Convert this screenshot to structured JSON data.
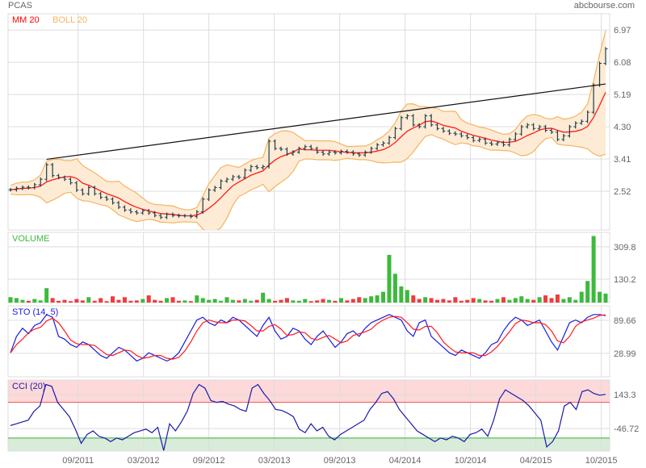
{
  "header": {
    "symbol": "PCAS",
    "source": "abcbourse.com"
  },
  "legend": {
    "ma": "MM 20",
    "boll": "BOLL 20",
    "volume": "VOLUME",
    "sto": "STO (14, 5)",
    "cci": "CCI (20)"
  },
  "colors": {
    "bar": "#1e3d4a",
    "ma": "#ff1a1a",
    "boll": "#f5b461",
    "boll_fill": "#fdebd5",
    "up": "#3cba3c",
    "down": "#f03c3c",
    "sto_k": "#1a1adf",
    "sto_d": "#ff1a1a",
    "cci": "#1a1aaa",
    "grid": "#dddddd"
  },
  "chart_data": [
    {
      "type": "line",
      "name": "price",
      "title": "PCAS",
      "y_ticks": [
        "6.97",
        "6.08",
        "5.19",
        "4.30",
        "3.41",
        "2.52"
      ],
      "ylim": [
        1.45,
        7.42
      ],
      "x_ticks": [
        {
          "label": "09/2011",
          "month": 8
        },
        {
          "label": "03/2012",
          "month": 14
        },
        {
          "label": "09/2012",
          "month": 20
        },
        {
          "label": "03/2013",
          "month": 26
        },
        {
          "label": "09/2013",
          "month": 32
        },
        {
          "label": "04/2014",
          "month": 38
        },
        {
          "label": "10/2014",
          "month": 44
        },
        {
          "label": "04/2015",
          "month": 50
        },
        {
          "label": "10/2015",
          "month": 56
        }
      ],
      "xlim_months": [
        1.8,
        56.4
      ],
      "close": [
        2.56,
        2.6,
        2.63,
        2.62,
        2.7,
        2.85,
        3.25,
        2.95,
        2.9,
        2.85,
        2.75,
        2.55,
        2.45,
        2.62,
        2.45,
        2.35,
        2.3,
        2.2,
        2.08,
        2.0,
        1.95,
        1.92,
        1.98,
        1.92,
        1.85,
        1.8,
        1.88,
        1.85,
        1.84,
        1.84,
        1.82,
        1.95,
        2.3,
        2.55,
        2.62,
        2.8,
        2.85,
        2.92,
        2.9,
        3.1,
        3.2,
        3.17,
        3.2,
        3.9,
        3.7,
        3.68,
        3.55,
        3.6,
        3.7,
        3.75,
        3.7,
        3.6,
        3.55,
        3.6,
        3.58,
        3.62,
        3.6,
        3.55,
        3.52,
        3.6,
        3.7,
        3.8,
        3.85,
        4.0,
        4.25,
        4.55,
        4.6,
        4.35,
        4.3,
        4.6,
        4.35,
        4.25,
        4.18,
        4.12,
        4.1,
        4.05,
        4.0,
        3.92,
        3.95,
        3.85,
        3.82,
        3.86,
        3.8,
        3.95,
        4.1,
        4.3,
        4.35,
        4.25,
        4.3,
        4.2,
        4.15,
        3.95,
        4.05,
        4.3,
        4.4,
        4.45,
        4.7,
        5.45,
        6.05,
        6.45
      ],
      "trendline": {
        "from_index": 6,
        "from_value": 3.4,
        "to_index": 99,
        "to_value": 5.48
      }
    },
    {
      "type": "bar",
      "name": "volume",
      "y_ticks": [
        "309.8",
        "130.2"
      ],
      "ylim": [
        0,
        390
      ],
      "values": [
        30,
        25,
        15,
        10,
        20,
        12,
        80,
        25,
        10,
        15,
        8,
        20,
        12,
        30,
        10,
        25,
        8,
        35,
        15,
        30,
        10,
        12,
        20,
        40,
        15,
        10,
        25,
        30,
        10,
        12,
        8,
        40,
        25,
        15,
        20,
        10,
        30,
        15,
        12,
        20,
        10,
        15,
        55,
        20,
        10,
        15,
        25,
        12,
        10,
        20,
        8,
        12,
        20,
        15,
        10,
        25,
        12,
        20,
        30,
        25,
        35,
        40,
        60,
        265,
        160,
        90,
        70,
        40,
        20,
        30,
        25,
        15,
        20,
        12,
        30,
        10,
        15,
        25,
        20,
        12,
        10,
        20,
        30,
        15,
        25,
        35,
        20,
        15,
        30,
        40,
        25,
        45,
        20,
        30,
        15,
        60,
        120,
        370,
        60,
        50
      ]
    },
    {
      "type": "line",
      "name": "stochastic",
      "y_ticks": [
        "89.66",
        "28.99"
      ],
      "ylim": [
        -14,
        116
      ],
      "k": [
        30,
        60,
        75,
        65,
        80,
        85,
        100,
        95,
        60,
        55,
        45,
        40,
        50,
        45,
        35,
        25,
        20,
        30,
        40,
        35,
        25,
        15,
        20,
        30,
        25,
        20,
        15,
        20,
        30,
        50,
        70,
        90,
        95,
        85,
        80,
        90,
        85,
        95,
        90,
        80,
        70,
        60,
        80,
        95,
        70,
        55,
        60,
        75,
        70,
        55,
        45,
        60,
        70,
        55,
        40,
        50,
        65,
        70,
        60,
        75,
        85,
        90,
        95,
        100,
        95,
        90,
        70,
        60,
        85,
        90,
        60,
        50,
        40,
        30,
        25,
        35,
        30,
        25,
        20,
        30,
        45,
        50,
        70,
        85,
        95,
        90,
        80,
        85,
        90,
        70,
        50,
        35,
        60,
        85,
        90,
        85,
        95,
        100,
        100,
        98
      ]
    },
    {
      "type": "line",
      "name": "cci",
      "y_ticks": [
        "143.3",
        "-46.72"
      ],
      "ylim": [
        -173,
        225
      ],
      "overbought": 100,
      "oversold": -100,
      "values": [
        -30,
        -20,
        -10,
        0,
        50,
        80,
        200,
        190,
        100,
        60,
        20,
        -50,
        -130,
        -80,
        -60,
        -90,
        -100,
        -120,
        -100,
        -110,
        -90,
        -70,
        -60,
        -50,
        -70,
        -40,
        -170,
        -20,
        -60,
        -10,
        50,
        150,
        200,
        180,
        110,
        100,
        105,
        90,
        80,
        60,
        50,
        180,
        200,
        150,
        110,
        60,
        55,
        40,
        20,
        -50,
        -70,
        -20,
        -60,
        -40,
        -90,
        -110,
        -80,
        -60,
        -40,
        -20,
        0,
        60,
        100,
        150,
        160,
        120,
        60,
        20,
        -20,
        -60,
        -80,
        -100,
        -120,
        -100,
        -110,
        -90,
        -100,
        -120,
        -80,
        -70,
        -50,
        -90,
        0,
        120,
        170,
        150,
        130,
        110,
        80,
        40,
        0,
        -150,
        -120,
        -60,
        80,
        100,
        60,
        160,
        170,
        150,
        140,
        145
      ]
    }
  ]
}
